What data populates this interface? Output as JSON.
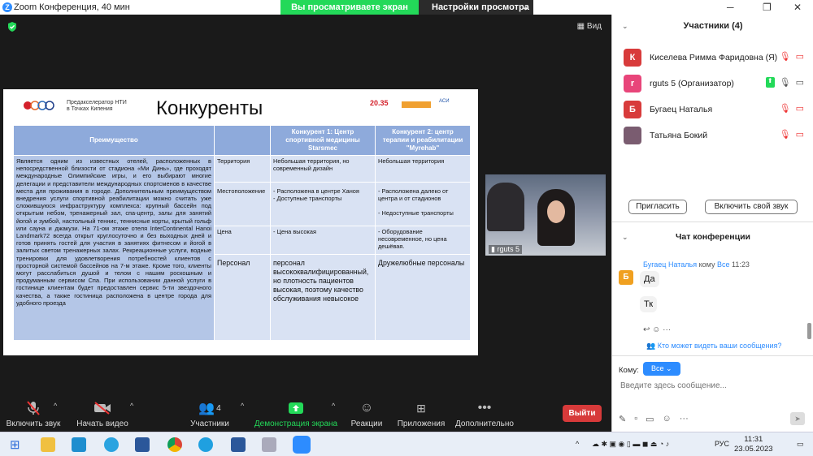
{
  "window": {
    "title": "Zoom Конференция, 40 мин"
  },
  "banner": {
    "sharing": "Вы просматриваете экран rguts 5",
    "options": "Настройки просмотра"
  },
  "stage": {
    "view_label": "Вид"
  },
  "slide": {
    "accelerator": "Предакселератор НТИ",
    "accelerator_sub": "в Точках Кипения",
    "title": "Конкуренты",
    "logo_2035": "20.35",
    "logo_plat": "ПЛАТФОРМА НТИ",
    "logo_asi": "АГЕНТСТВО СТРАТЕГИЧЕСКИХ ИНИЦИАТИВ",
    "col_headers": [
      "Преимущество",
      "",
      "Конкурент 1:  Центр спортивной медицины Starsmec",
      "Конкурент 2: центр терапии и реабилитации \"Myrehab\""
    ],
    "advantage_text": "Является одним из известных отелей, расположенных в непосредственной близости от стадиона «Ми Динь», где проходят международные Олимпийские игры, и его выбирают многие делегации и представители международных спортсменов в качестве места для проживания в городе. Дополнительным преимуществом внедрения услуги спортивной реабилитации можно считать уже сложившуюся инфраструктуру комплекса: крупный бассейн под открытым небом, тренажерный зал, спа-центр, залы для занятий йогой и зумбой, настольный теннис, теннисные корты, крытый гольф или сауна и джакузи. На 71-ом этаже отеля InterContinental Hanoi Landmark72 всегда открыт круглосуточно и без выходных дней и готов принять гостей для участия в занятиях фитнесом и йогой в залитых светом тренажерных залах. Рекреационные услуги, водные тренировки для удовлетворения потребностей клиентов с просторной системой бассейнов на 7-м этаже. Кроме того, клиенты могут расслабиться душой и телом с нашим роскошным и продуманным сервисом Спа. При использовании данной услуги в гостинице клиентам будет предоставлен сервис 5-ти звездочного качества, а также гостиница расположена в центре города для удобного проезда",
    "rows": [
      {
        "label": "Территория",
        "c1": "Небольшая территория, но современный дизайн",
        "c2": "Небольшая территория"
      },
      {
        "label": "Местоположение",
        "c1": "-     Расположена в центре Ханоя\n-     Доступные транспорты",
        "c2": "-     Расположена далеко от центра и от стадионов\n\n-   Недоступные транспорты"
      },
      {
        "label": "Цена",
        "c1": "- Цена высокая",
        "c2": "- Оборудование несовременное, но цена дешёвая."
      },
      {
        "label": "Персонал",
        "c1": "персонал высококвалифицированный, но плотность пациентов высокая, поэтому качество обслуживания невысокое",
        "c2": "Дружелюбные персоналы"
      }
    ]
  },
  "camera": {
    "name": "rguts 5"
  },
  "toolbar": {
    "mute": "Включить звук",
    "video": "Начать видео",
    "participants": "Участники",
    "participants_count": "4",
    "share": "Демонстрация экрана",
    "reactions": "Реакции",
    "apps": "Приложения",
    "more": "Дополнительно",
    "leave": "Выйти"
  },
  "panel": {
    "title": "Участники (4)",
    "participants": [
      {
        "initial": "К",
        "name": "Киселева Римма Фаридовна (Я)",
        "color": "#d83b3b"
      },
      {
        "initial": "r",
        "name": "rguts 5 (Организатор)",
        "color": "#e8457a"
      },
      {
        "initial": "Б",
        "name": "Бугаец Наталья",
        "color": "#d83b3b"
      },
      {
        "initial": "",
        "name": "Татьяна Бокий",
        "color": "#7a5c70"
      }
    ],
    "invite": "Пригласить",
    "unmute_me": "Включить свой звук"
  },
  "chat": {
    "title": "Чат конференции",
    "sender": "Бугаец Наталья",
    "to_word": "кому",
    "to_target": "Все",
    "time": "11:23",
    "sender_initial": "Б",
    "messages": [
      "Да",
      "Тк"
    ],
    "who_can_see": "Кто может видеть ваши сообщения?",
    "to_label": "Кому:",
    "to_value": "Все",
    "placeholder": "Введите здесь сообщение..."
  },
  "taskbar": {
    "lang": "РУС",
    "time": "11:31",
    "date": "23.05.2023"
  }
}
